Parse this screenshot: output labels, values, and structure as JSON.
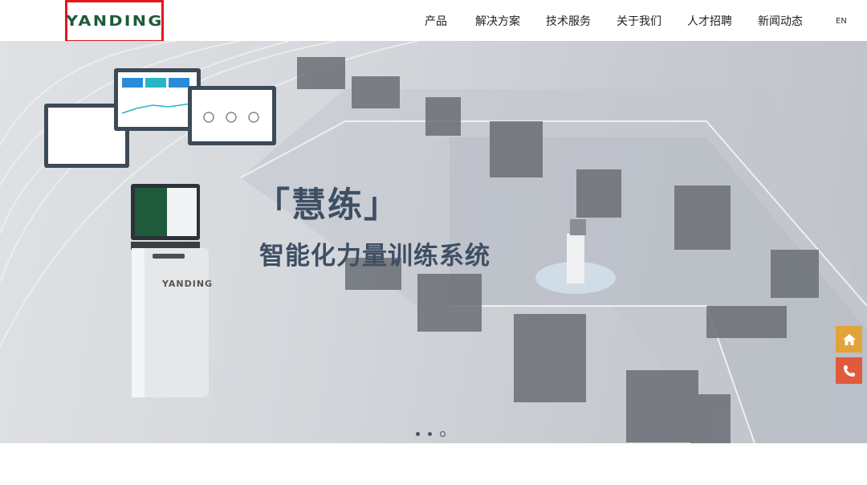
{
  "header": {
    "logo_text": "YANDING",
    "nav": [
      "产品",
      "解决方案",
      "技术服务",
      "关于我们",
      "人才招聘",
      "新闻动态"
    ],
    "lang": "EN"
  },
  "banner": {
    "headline": "「慧练」",
    "subline": "智能化力量训练系统",
    "kiosk_brand": "YANDING",
    "slides_total": 3,
    "slide_active": 3
  },
  "side_buttons": {
    "home_icon": "home-icon",
    "phone_icon": "phone-icon",
    "home_color": "#e2a339",
    "phone_color": "#e25a3d"
  }
}
